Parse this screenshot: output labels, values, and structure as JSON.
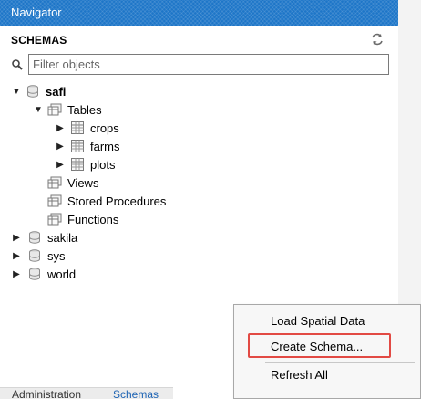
{
  "navigator": {
    "title": "Navigator"
  },
  "schemas_section": {
    "header": "SCHEMAS",
    "filter_placeholder": "Filter objects"
  },
  "tree": {
    "safi": {
      "label": "safi"
    },
    "tables": {
      "label": "Tables"
    },
    "crops": {
      "label": "crops"
    },
    "farms": {
      "label": "farms"
    },
    "plots": {
      "label": "plots"
    },
    "views": {
      "label": "Views"
    },
    "stored_procedures": {
      "label": "Stored Procedures"
    },
    "functions": {
      "label": "Functions"
    },
    "sakila": {
      "label": "sakila"
    },
    "sys": {
      "label": "sys"
    },
    "world": {
      "label": "world"
    }
  },
  "context_menu": {
    "load_spatial": "Load Spatial Data",
    "create_schema": "Create Schema...",
    "refresh_all": "Refresh All"
  },
  "bottom_tabs": {
    "administration": "Administration",
    "schemas": "Schemas"
  },
  "colors": {
    "titlebar": "#1e76c8",
    "highlight": "#e24a44",
    "active_tab": "#1e64b4"
  }
}
